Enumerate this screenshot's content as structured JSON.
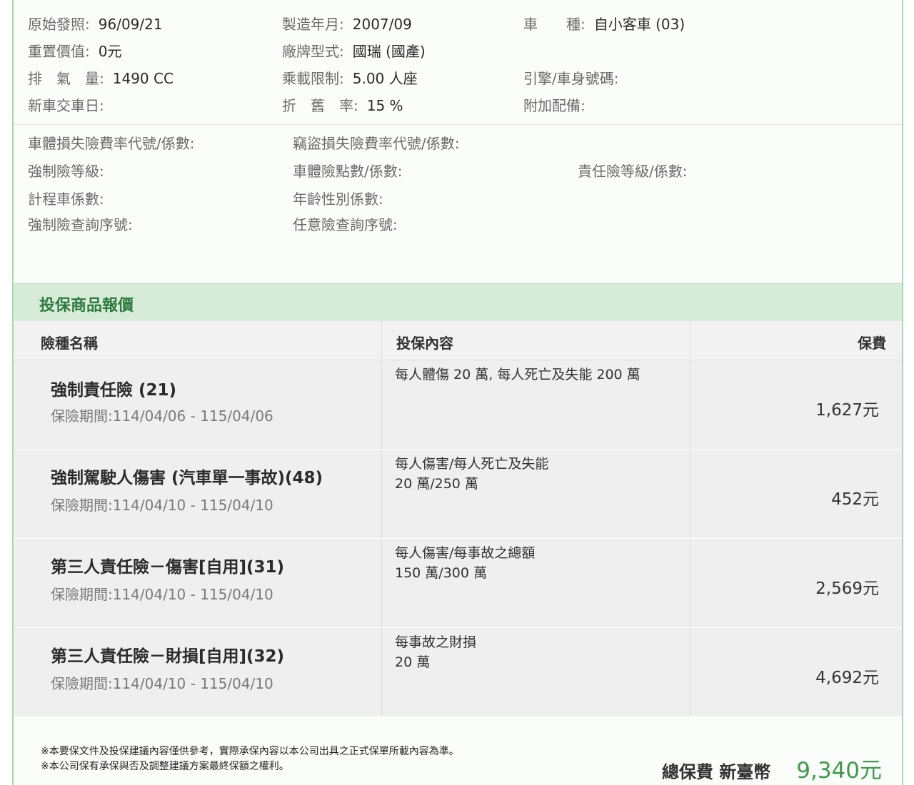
{
  "vehicle": {
    "first_issue_label": "原始發照:",
    "first_issue_value": "96/09/21",
    "mfg_label": "製造年月:",
    "mfg_value": "2007/09",
    "type_label": "車　　種:",
    "type_value": "自小客車 (03)",
    "reset_value_label": "重置價值:",
    "reset_value_value": "0元",
    "brand_label": "廠牌型式:",
    "brand_value": "國瑞 (國產)",
    "displacement_label": "排　氣　量:",
    "displacement_value": "1490 CC",
    "capacity_label": "乘載限制:",
    "capacity_value": "5.00 人座",
    "engine_label": "引擎/車身號碼:",
    "delivery_label": "新車交車日:",
    "depreciation_label": "折　舊　率:",
    "depreciation_value": "15 %",
    "accessories_label": "附加配備:"
  },
  "coefficients": {
    "body_rate_label": "車體損失險費率代號/係數:",
    "theft_rate_label": "竊盜損失險費率代號/係數:",
    "compulsory_level_label": "強制險等級:",
    "body_points_label": "車體險點數/係數:",
    "liability_level_label": "責任險等級/係數:",
    "taxi_label": "計程車係數:",
    "age_gender_label": "年齡性別係數:",
    "compulsory_query_label": "強制險查詢序號:",
    "voluntary_query_label": "任意險查詢序號:"
  },
  "section": {
    "title": "投保商品報價"
  },
  "table": {
    "headers": {
      "name": "險種名稱",
      "content": "投保內容",
      "fee": "保費"
    },
    "rows": [
      {
        "name": "強制責任險 (21)",
        "period": "保險期間:114/04/06 - 115/04/06",
        "content_line1": "每人體傷 20 萬, 每人死亡及失能 200 萬",
        "content_line2": "",
        "fee": "1,627元"
      },
      {
        "name": "強制駕駛人傷害 (汽車單一事故)(48)",
        "period": "保險期間:114/04/10 - 115/04/10",
        "content_line1": "每人傷害/每人死亡及失能",
        "content_line2": "20 萬/250 萬",
        "fee": "452元"
      },
      {
        "name": "第三人責任險－傷害[自用](31)",
        "period": "保險期間:114/04/10 - 115/04/10",
        "content_line1": "每人傷害/每事故之總額",
        "content_line2": "150 萬/300 萬",
        "fee": "2,569元"
      },
      {
        "name": "第三人責任險－財損[自用](32)",
        "period": "保險期間:114/04/10 - 115/04/10",
        "content_line1": "每事故之財損",
        "content_line2": "20 萬",
        "fee": "4,692元"
      }
    ]
  },
  "footer": {
    "note1": "※本要保文件及投保建議內容僅供參考，實際承保內容以本公司出具之正式保單所載內容為準。",
    "note2": "※本公司保有承保與否及調整建議方案最終保額之權利。",
    "total_label": "總保費 新臺幣",
    "total_value": "9,340元"
  },
  "colors": {
    "accent_green": "#3f9a4c",
    "header_bg": "#d7ecd8",
    "border_green": "#a9d7b0"
  }
}
